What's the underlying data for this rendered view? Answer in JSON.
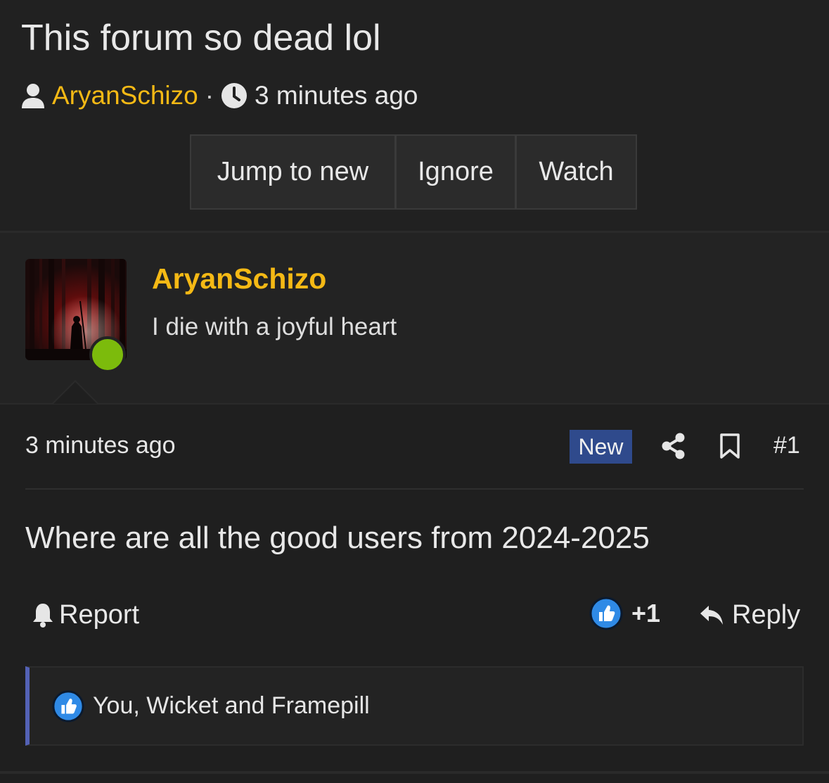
{
  "thread": {
    "title": "This forum so dead lol",
    "author": "AryanSchizo",
    "separator": "·",
    "time": "3 minutes ago",
    "buttons": {
      "jump": "Jump to new",
      "ignore": "Ignore",
      "watch": "Watch"
    }
  },
  "post": {
    "user": {
      "name": "AryanSchizo",
      "title": "I die with a joyful heart",
      "online": true
    },
    "time": "3 minutes ago",
    "badge": "New",
    "number": "#1",
    "body": "Where are all the good users from 2024-2025",
    "actions": {
      "report": "Report",
      "reaction_count": "+1",
      "reply": "Reply"
    },
    "reactions": {
      "reactors": "You, Wicket and Framepill"
    }
  },
  "colors": {
    "accent_username": "#f5b915",
    "online": "#7cbb0c",
    "new_badge": "#2f4a8c",
    "like_blue": "#2f8ae6",
    "reactions_border": "#5361b5",
    "background": "#1f1f1f"
  },
  "icons": {
    "user": "user-icon",
    "clock": "clock-icon",
    "share": "share-icon",
    "bookmark": "bookmark-icon",
    "bell": "bell-icon",
    "like": "thumbs-up-icon",
    "reply": "reply-icon"
  }
}
